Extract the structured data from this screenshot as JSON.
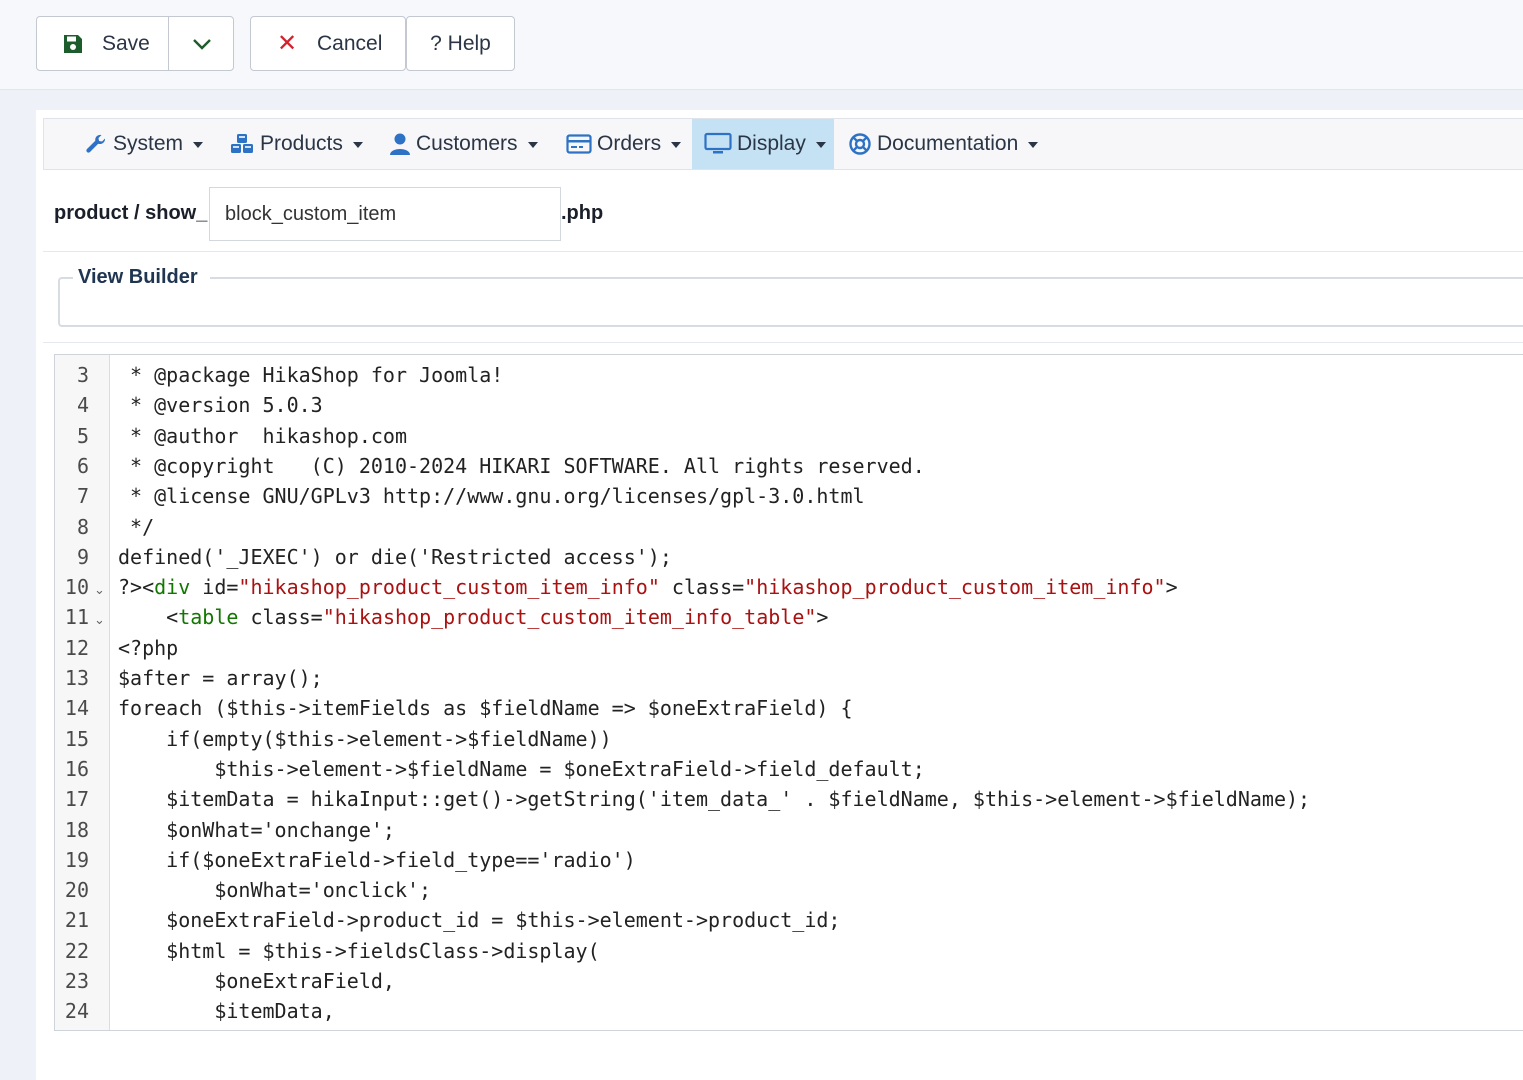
{
  "toolbar": {
    "save_label": "Save",
    "cancel_label": "Cancel",
    "help_label": "? Help"
  },
  "menu": {
    "items": [
      {
        "label": "System",
        "icon": "wrench-icon"
      },
      {
        "label": "Products",
        "icon": "cubes-icon"
      },
      {
        "label": "Customers",
        "icon": "user-icon"
      },
      {
        "label": "Orders",
        "icon": "credit-card-icon"
      },
      {
        "label": "Display",
        "icon": "monitor-icon",
        "active": true
      },
      {
        "label": "Documentation",
        "icon": "life-ring-icon"
      }
    ]
  },
  "file": {
    "prefix": "product / show_",
    "name_value": "block_custom_item",
    "suffix": ".php"
  },
  "view_builder": {
    "legend": "View Builder"
  },
  "editor": {
    "lines": [
      {
        "n": "3",
        "text": " * @package HikaShop for Joomla!"
      },
      {
        "n": "4",
        "text": " * @version 5.0.3"
      },
      {
        "n": "5",
        "text": " * @author  hikashop.com"
      },
      {
        "n": "6",
        "text": " * @copyright   (C) 2010-2024 HIKARI SOFTWARE. All rights reserved."
      },
      {
        "n": "7",
        "text": " * @license GNU/GPLv3 http://www.gnu.org/licenses/gpl-3.0.html"
      },
      {
        "n": "8",
        "text": " */"
      },
      {
        "n": "9",
        "text": "defined('_JEXEC') or die('Restricted access');"
      },
      {
        "n": "10",
        "fold": true,
        "tokens": [
          {
            "t": "?><",
            "c": ""
          },
          {
            "t": "div",
            "c": "t-tag"
          },
          {
            "t": " id=",
            "c": "t-attr"
          },
          {
            "t": "\"hikashop_product_custom_item_info\"",
            "c": "t-str"
          },
          {
            "t": " class=",
            "c": "t-attr"
          },
          {
            "t": "\"hikashop_product_custom_item_info\"",
            "c": "t-str"
          },
          {
            "t": ">",
            "c": ""
          }
        ]
      },
      {
        "n": "11",
        "fold": true,
        "tokens": [
          {
            "t": "    <",
            "c": ""
          },
          {
            "t": "table",
            "c": "t-tag"
          },
          {
            "t": " class=",
            "c": "t-attr"
          },
          {
            "t": "\"hikashop_product_custom_item_info_table\"",
            "c": "t-str"
          },
          {
            "t": ">",
            "c": ""
          }
        ]
      },
      {
        "n": "12",
        "text": "<?php"
      },
      {
        "n": "13",
        "text": "$after = array();"
      },
      {
        "n": "14",
        "text": "foreach ($this->itemFields as $fieldName => $oneExtraField) {"
      },
      {
        "n": "15",
        "text": "    if(empty($this->element->$fieldName))"
      },
      {
        "n": "16",
        "text": "        $this->element->$fieldName = $oneExtraField->field_default;"
      },
      {
        "n": "17",
        "text": "    $itemData = hikaInput::get()->getString('item_data_' . $fieldName, $this->element->$fieldName);"
      },
      {
        "n": "18",
        "text": "    $onWhat='onchange';"
      },
      {
        "n": "19",
        "text": "    if($oneExtraField->field_type=='radio')"
      },
      {
        "n": "20",
        "text": "        $onWhat='onclick';"
      },
      {
        "n": "21",
        "text": "    $oneExtraField->product_id = $this->element->product_id;"
      },
      {
        "n": "22",
        "text": "    $html = $this->fieldsClass->display("
      },
      {
        "n": "23",
        "text": "        $oneExtraField,"
      },
      {
        "n": "24",
        "text": "        $itemData,"
      }
    ]
  }
}
